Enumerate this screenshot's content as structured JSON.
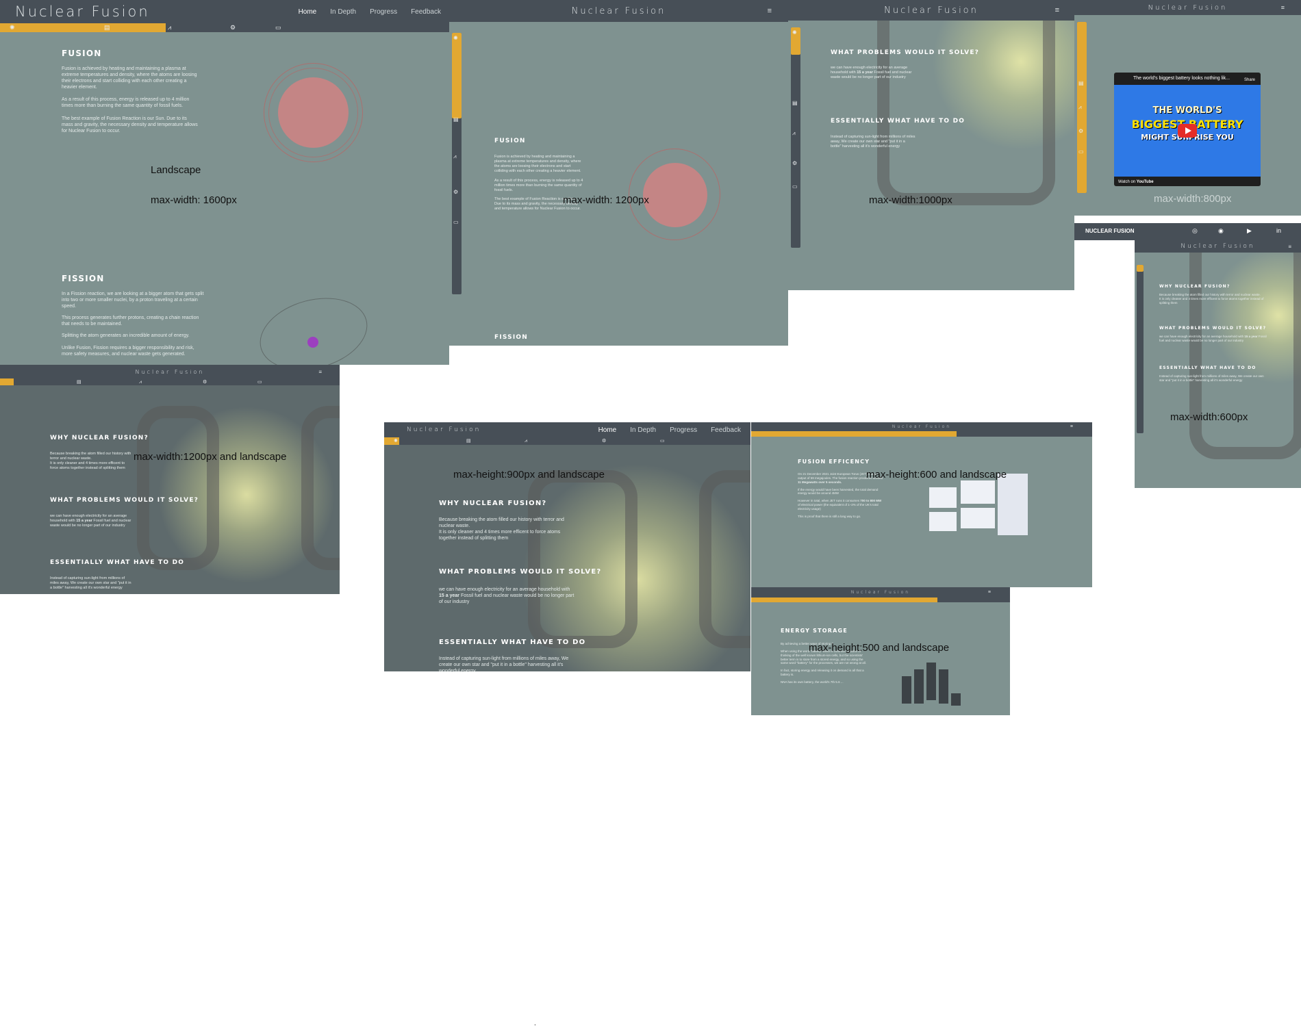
{
  "brand": "Nuclear Fusion",
  "nav": {
    "home": "Home",
    "in_depth": "In Depth",
    "progress": "Progress",
    "feedback": "Feedback"
  },
  "menu_glyph": "≡",
  "labels": {
    "landscape": "Landscape",
    "mw1600": "max-width: 1600px",
    "mw1200": "max-width: 1200px",
    "mw1000": "max-width:1000px",
    "mw800": "max-width:800px",
    "mw600": "max-width:600px",
    "mw1200_land": "max-width:1200px  and landscape",
    "mh900": "max-height:900px and landscape",
    "mh600": "max-height:600 and landscape",
    "mh500": "max-height:500 and landscape"
  },
  "fusion": {
    "title": "FUSION",
    "p1": "Fusion is achieved by heating and maintaining a plasma at extreme temperatures and density, where the atoms are loosing their electrons and start colliding with each other creating a heavier element.",
    "p2": "As a result of this process, energy is released up to 4 million times more than burning the same quantity of fossil fuels.",
    "p3": "The best example of Fusion Reaction is our Sun. Due to its mass and gravity, the necessary density and temperature allows for Nuclear Fusion to occur."
  },
  "fission": {
    "title": "FISSION",
    "p1": "In a Fission reaction, we are looking at a bigger atom that gets split into two or more smaller nuclei, by a proton traveling at a certain speed.",
    "p2": "This process generates further protons, creating a chain reaction that needs to be maintained.",
    "p3": "Splitting the atom generates an incredible amount of energy.",
    "p4": "Unlike Fusion, Fission requires a bigger responsibility and risk, more safety measures, and nuclear waste gets generated."
  },
  "why": {
    "title": "WHY NUCLEAR FUSION?",
    "p1": "Because breaking the atom filled our history with terror and nuclear waste.",
    "p2": "It is only cleaner and 4 times more efficent to force atoms together instead of splitting them"
  },
  "problems": {
    "title": "WHAT PROBLEMS WOULD IT SOLVE?",
    "p1": "we can have enough electricity for an average household with",
    "highlight": "15 a year",
    "p2": "Fossil fuel and nuclear waste would be no longer part of our industry"
  },
  "essential": {
    "title": "ESSENTIALLY WHAT HAVE TO DO",
    "p1": "Instead of capturing sun-light from millions of miles away, We create our own star and \"put it in a bottle\" harvesting all it's wonderful energy"
  },
  "efficiency": {
    "title": "FUSION EFFICENCY",
    "p1": "On 21 December 2021 Joint European Torus (JET) had an output of 59 megajoules. The fusion reaction produced around",
    "p1_bold": "11 Megawatts over 5 seconds.",
    "p2": "If the energy would have been harvested, the total demand energy would be around 4MW",
    "p3": "However in total, when JET runs it consumes",
    "p3_bold": "700 to 800 MW",
    "p3_tail": "of electrical power (the equivalent of 1–2% of the UK's total electricity usage)",
    "p4": "This is proof that there is still a long way to go."
  },
  "storage": {
    "title": "ENERGY STORAGE",
    "p1": "By achieving a better ways of storing it",
    "p2": "When using the word \"battery\" there is common practice of thinking of the well known lithium-ion cells, but the scientists' better term is to store from a stored energy, and so using the same word \"battery\" for the processes, we are not wrong at all.",
    "p3": "In fact, storing energy and releasing it on demand is all that a battery is.",
    "p4": "NNA has its own battery, the world's 7th 5.6 ..."
  },
  "youtube": {
    "title": "The world's biggest battery looks nothing lik...",
    "line1": "THE WORLD'S",
    "line2": "BIGGEST BATTERY",
    "line3": "MIGHT SURPRISE YOU",
    "watch_on": "Watch on",
    "youtube": "YouTube",
    "share": "Share"
  },
  "mobile_bar": {
    "title": "NUCLEAR FUSION"
  },
  "footer_dot": "."
}
